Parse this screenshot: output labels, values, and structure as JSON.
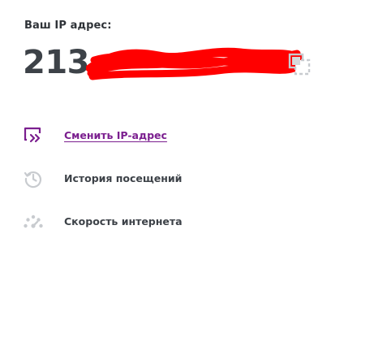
{
  "ip": {
    "label": "Ваш IP адрес:",
    "value": "213.",
    "copy_icon": "copy-icon"
  },
  "menu": {
    "items": [
      {
        "label": "Сменить IP-адрес",
        "icon": "change-ip-icon",
        "active": true,
        "color": "#7b1f8f"
      },
      {
        "label": "История посещений",
        "icon": "history-icon",
        "active": false
      },
      {
        "label": "Скорость интернета",
        "icon": "speedometer-icon",
        "active": false
      }
    ]
  },
  "colors": {
    "accent": "#7b1f8f",
    "text": "#3d4248",
    "icon_gray": "#c8cbcf",
    "redaction": "#ff0000"
  }
}
